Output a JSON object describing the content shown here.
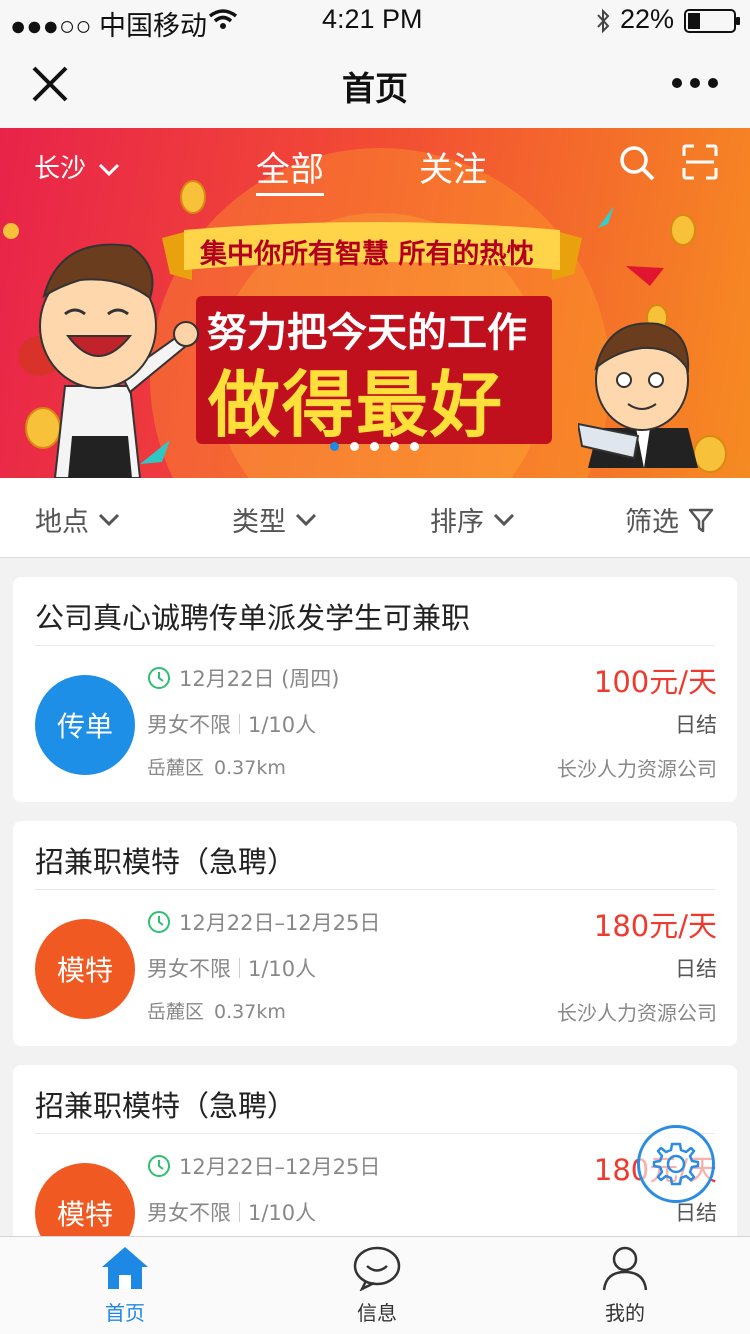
{
  "status_bar": {
    "carrier": "●●●○○ 中国移动",
    "time": "4:21 PM",
    "battery": "22%"
  },
  "nav": {
    "title": "首页"
  },
  "banner": {
    "city": "长沙",
    "tabs": [
      "全部",
      "关注"
    ],
    "active_tab": 0,
    "slogan_line1": "集中你所有智慧 所有的热忱",
    "slogan_line2": "努力把今天的工作",
    "slogan_line3": "做得最好",
    "slide_count": 5,
    "active_slide": 0
  },
  "filters": [
    "地点",
    "类型",
    "排序",
    "筛选"
  ],
  "jobs": [
    {
      "title": "公司真心诚聘传单派发学生可兼职",
      "tag": "传单",
      "tag_color": "#1e8fe6",
      "date": "12月22日 (周四)",
      "gender": "男女不限",
      "count": "1/10人",
      "district": "岳麓区",
      "distance": "0.37km",
      "salary": "100元/天",
      "settlement": "日结",
      "company": "长沙人力资源公司"
    },
    {
      "title": "招兼职模特（急聘）",
      "tag": "模特",
      "tag_color": "#f05a22",
      "date": "12月22日–12月25日",
      "gender": "男女不限",
      "count": "1/10人",
      "district": "岳麓区",
      "distance": "0.37km",
      "salary": "180元/天",
      "settlement": "日结",
      "company": "长沙人力资源公司"
    },
    {
      "title": "招兼职模特（急聘）",
      "tag": "模特",
      "tag_color": "#f05a22",
      "date": "12月22日–12月25日",
      "gender": "男女不限",
      "count": "1/10人",
      "district": "",
      "distance": "",
      "salary": "180元/天",
      "settlement": "日结",
      "company": ""
    }
  ],
  "tabbar": [
    {
      "label": "首页",
      "icon": "home-icon"
    },
    {
      "label": "信息",
      "icon": "chat-icon"
    },
    {
      "label": "我的",
      "icon": "user-icon"
    }
  ],
  "active_tab_index": 0,
  "colors": {
    "accent": "#1e88e5",
    "salary": "#ef3b2f"
  }
}
